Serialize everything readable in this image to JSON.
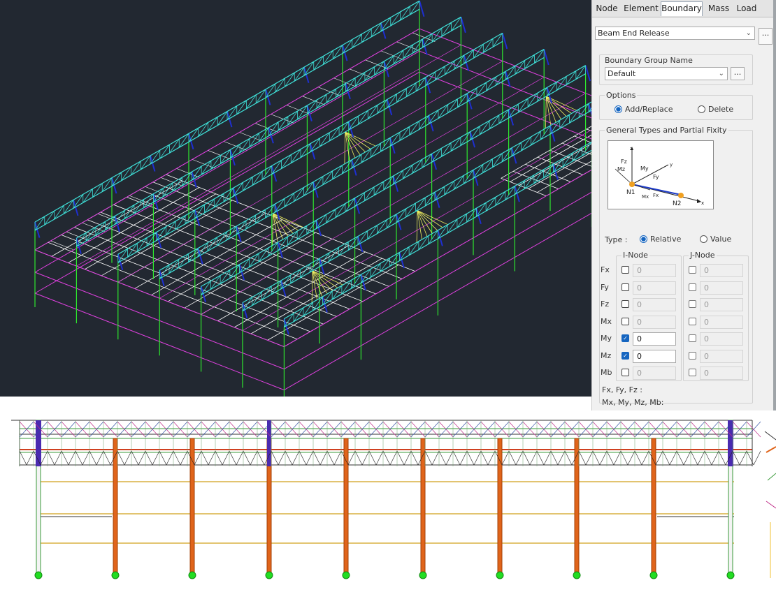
{
  "tabs": [
    "Node",
    "Element",
    "Boundary",
    "Mass",
    "Load"
  ],
  "active_tab": "Boundary",
  "function_select": {
    "value": "Beam End Release",
    "more": "..."
  },
  "boundary_group": {
    "label": "Boundary Group Name",
    "value": "Default",
    "more": "..."
  },
  "options": {
    "label": "Options",
    "add": "Add/Replace",
    "delete": "Delete",
    "selected": "add"
  },
  "general": {
    "label": "General Types and Partial Fixity",
    "diagram_labels": {
      "z": "z",
      "y": "y",
      "x": "x",
      "fz": "Fz",
      "mz": "Mz",
      "my": "My",
      "fy": "Fy",
      "mx": "Mx",
      "fx": "Fx",
      "n1": "N1",
      "n2": "N2"
    }
  },
  "type": {
    "label": "Type :",
    "relative": "Relative",
    "value": "Value",
    "selected": "relative"
  },
  "i_node": {
    "label": "I-Node"
  },
  "j_node": {
    "label": "J-Node"
  },
  "rows": [
    {
      "name": "Fx",
      "i_checked": false,
      "i_value": "0",
      "j_checked": false,
      "j_value": "0"
    },
    {
      "name": "Fy",
      "i_checked": false,
      "i_value": "0",
      "j_checked": false,
      "j_value": "0"
    },
    {
      "name": "Fz",
      "i_checked": false,
      "i_value": "0",
      "j_checked": false,
      "j_value": "0"
    },
    {
      "name": "Mx",
      "i_checked": false,
      "i_value": "0",
      "j_checked": false,
      "j_value": "0"
    },
    {
      "name": "My",
      "i_checked": true,
      "i_value": "0",
      "j_checked": false,
      "j_value": "0"
    },
    {
      "name": "Mz",
      "i_checked": true,
      "i_value": "0",
      "j_checked": false,
      "j_value": "0"
    },
    {
      "name": "Mb",
      "i_checked": false,
      "i_value": "0",
      "j_checked": false,
      "j_value": "0"
    }
  ],
  "footer": {
    "line1": "Fx, Fy, Fz       :",
    "line2": "Mx, My, Mz, Mb:"
  },
  "colors": {
    "viewport_bg": "#222831",
    "truss": "#3fe0d8",
    "purlin": "#1e2fd0",
    "column": "#2ee82e",
    "floor": "#ffffff",
    "edge": "#e040e0",
    "brace": "#f0f060",
    "elev_column": "#e0641a",
    "elev_chord": "#3a9a3a",
    "elev_diag": "#c0308a",
    "elev_support": "#22dd22"
  }
}
